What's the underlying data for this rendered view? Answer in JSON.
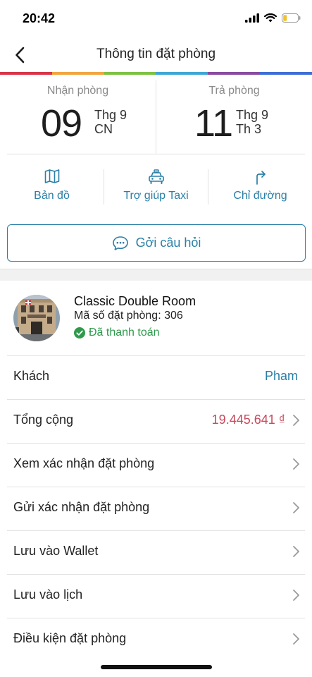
{
  "status_bar": {
    "time": "20:42"
  },
  "nav": {
    "title": "Thông tin đặt phòng"
  },
  "colors": {
    "accent": "#2a7fa6",
    "price": "#c9485b",
    "paid": "#2e9a4c",
    "rainbow": [
      "#d8344a",
      "#f2a540",
      "#7dc242",
      "#3fa7d6",
      "#8a4ba0",
      "#3f6fd6"
    ]
  },
  "checkin": {
    "label": "Nhận phòng",
    "day": "09",
    "month": "Thg 9",
    "weekday": "CN"
  },
  "checkout": {
    "label": "Trả phòng",
    "day": "11",
    "month": "Thg 9",
    "weekday": "Th 3"
  },
  "actions": [
    {
      "label": "Bản đồ",
      "icon": "map-icon"
    },
    {
      "label": "Trợ giúp Taxi",
      "icon": "taxi-icon"
    },
    {
      "label": "Chỉ đường",
      "icon": "directions-icon"
    }
  ],
  "ask_button": {
    "label": "Gởi câu hỏi",
    "icon": "chat-bubble-icon"
  },
  "room": {
    "name": "Classic Double Room",
    "code": "Mã số đặt phòng: 306",
    "status": "Đã thanh toán"
  },
  "rows": [
    {
      "label": "Khách",
      "value": "Pham",
      "chevron": false
    },
    {
      "label": "Tổng cộng",
      "value": "19.445.641 ₫",
      "chevron": true
    },
    {
      "label": "Xem xác nhận đặt phòng",
      "value": "",
      "chevron": true
    },
    {
      "label": "Gửi xác nhận đặt phòng",
      "value": "",
      "chevron": true
    },
    {
      "label": "Lưu vào Wallet",
      "value": "",
      "chevron": true
    },
    {
      "label": "Lưu vào lịch",
      "value": "",
      "chevron": true
    },
    {
      "label": "Điều kiện đặt phòng",
      "value": "",
      "chevron": true
    }
  ]
}
